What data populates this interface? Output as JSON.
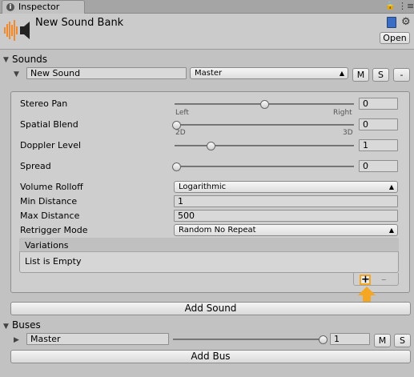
{
  "tab": {
    "title": "Inspector"
  },
  "header": {
    "title": "New Sound Bank",
    "open_label": "Open"
  },
  "sounds": {
    "section_label": "Sounds",
    "sound_name": "New Sound",
    "bus_select": "Master",
    "m_label": "M",
    "s_label": "S",
    "remove_label": "-",
    "props": {
      "stereo_pan": {
        "label": "Stereo Pan",
        "value": "0",
        "min_label": "Left",
        "max_label": "Right",
        "level": 0.5
      },
      "spatial_blend": {
        "label": "Spatial Blend",
        "value": "0",
        "min_label": "2D",
        "max_label": "3D",
        "level": 0.0
      },
      "doppler_level": {
        "label": "Doppler Level",
        "value": "1",
        "level": 0.2
      },
      "spread": {
        "label": "Spread",
        "value": "0",
        "level": 0.0
      },
      "volume_rolloff": {
        "label": "Volume Rolloff",
        "value": "Logarithmic"
      },
      "min_distance": {
        "label": "Min Distance",
        "value": "1"
      },
      "max_distance": {
        "label": "Max Distance",
        "value": "500"
      },
      "retrigger_mode": {
        "label": "Retrigger Mode",
        "value": "Random No Repeat"
      }
    },
    "variations": {
      "header": "Variations",
      "empty_text": "List is Empty",
      "add_icon": "plus-icon",
      "remove_icon": "minus-icon"
    },
    "add_sound_label": "Add Sound"
  },
  "buses": {
    "section_label": "Buses",
    "bus_name": "Master",
    "bus_value": "1",
    "bus_level": 1.0,
    "m_label": "M",
    "s_label": "S",
    "add_bus_label": "Add Bus"
  },
  "colors": {
    "highlight": "#f5a623",
    "panel_bg": "#c2c2c2"
  }
}
